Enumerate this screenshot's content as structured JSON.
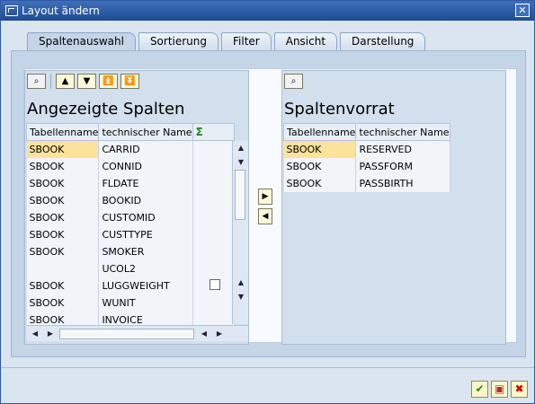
{
  "window": {
    "title": "Layout ändern",
    "close_label": "✕"
  },
  "tabs": [
    {
      "label": "Spaltenauswahl",
      "active": true
    },
    {
      "label": "Sortierung",
      "active": false
    },
    {
      "label": "Filter",
      "active": false
    },
    {
      "label": "Ansicht",
      "active": false
    },
    {
      "label": "Darstellung",
      "active": false
    }
  ],
  "left": {
    "title": "Angezeigte Spalten",
    "headers": [
      "Tabellenname",
      "technischer Name",
      "Σ"
    ],
    "rows": [
      {
        "table": "SBOOK",
        "name": "CARRID"
      },
      {
        "table": "SBOOK",
        "name": "CONNID"
      },
      {
        "table": "SBOOK",
        "name": "FLDATE"
      },
      {
        "table": "SBOOK",
        "name": "BOOKID"
      },
      {
        "table": "SBOOK",
        "name": "CUSTOMID"
      },
      {
        "table": "SBOOK",
        "name": "CUSTTYPE"
      },
      {
        "table": "SBOOK",
        "name": "SMOKER"
      },
      {
        "table": "",
        "name": "UCOL2"
      },
      {
        "table": "SBOOK",
        "name": "LUGGWEIGHT"
      },
      {
        "table": "SBOOK",
        "name": "WUNIT"
      },
      {
        "table": "SBOOK",
        "name": "INVOICE"
      }
    ],
    "toolbar": [
      "find-icon",
      "arrow-up-icon",
      "arrow-down-icon",
      "first-icon",
      "last-icon"
    ]
  },
  "right": {
    "title": "Spaltenvorrat",
    "headers": [
      "Tabellenname",
      "technischer Name"
    ],
    "rows": [
      {
        "table": "SBOOK",
        "name": "RESERVED"
      },
      {
        "table": "SBOOK",
        "name": "PASSFORM"
      },
      {
        "table": "SBOOK",
        "name": "PASSBIRTH"
      }
    ]
  },
  "colors": {
    "accent": "#2d5aa0",
    "selected": "#fbe39c"
  }
}
